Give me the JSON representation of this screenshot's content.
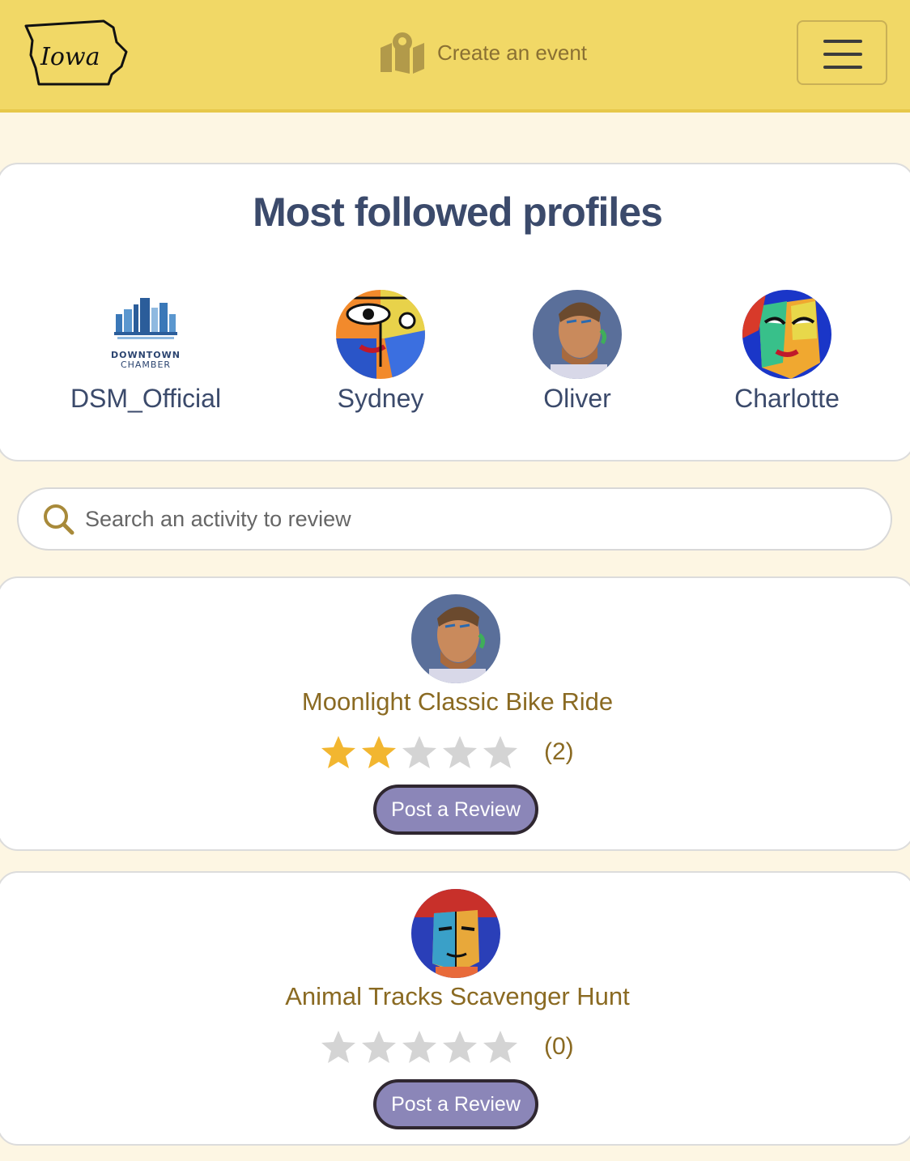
{
  "header": {
    "logo_text": "Iowa",
    "create_event_label": "Create an event",
    "menu_icon": "hamburger-menu-icon"
  },
  "profiles": {
    "title": "Most followed profiles",
    "items": [
      {
        "name": "DSM_Official",
        "avatar": "downtown-chamber-logo",
        "logo_text_1": "DOWNTOWN",
        "logo_text_2": "CHAMBER"
      },
      {
        "name": "Sydney",
        "avatar": "cubist-face-art"
      },
      {
        "name": "Oliver",
        "avatar": "painted-portrait-art"
      },
      {
        "name": "Charlotte",
        "avatar": "colorful-face-art"
      }
    ]
  },
  "search": {
    "placeholder": "Search an activity to review",
    "icon": "search-icon"
  },
  "activities": [
    {
      "title": "Moonlight Classic Bike Ride",
      "rating": 2,
      "max_rating": 5,
      "count_label": "(2)",
      "button_label": "Post a Review",
      "avatar": "painted-portrait-art"
    },
    {
      "title": "Animal Tracks Scavenger Hunt",
      "rating": 0,
      "max_rating": 5,
      "count_label": "(0)",
      "button_label": "Post a Review",
      "avatar": "cubist-man-art"
    }
  ],
  "colors": {
    "header_bg": "#f1d866",
    "page_bg": "#fdf6e3",
    "title_blue": "#3b4a6b",
    "gold_text": "#8a6a22",
    "star_filled": "#f2b630",
    "star_empty": "#d4d4d4",
    "button_purple": "#8b86b8"
  }
}
